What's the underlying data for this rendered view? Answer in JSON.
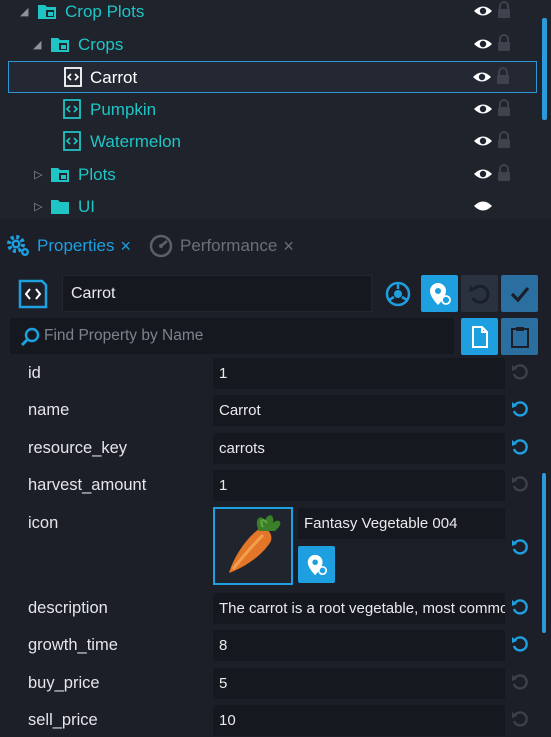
{
  "colors": {
    "accent": "#2c9ad8",
    "tree_text": "#1fc5c5",
    "panel_bg": "#1f232c",
    "field_bg": "#15181e",
    "active_blue": "#1e9fe0",
    "muted": "#6a6f79"
  },
  "tree": {
    "items": [
      {
        "label": "Crop Plots",
        "icon": "folder-icon",
        "expanded": true
      },
      {
        "label": "Crops",
        "icon": "folder-icon",
        "expanded": true
      },
      {
        "label": "Carrot",
        "icon": "script-data-icon",
        "selected": true
      },
      {
        "label": "Pumpkin",
        "icon": "script-data-icon"
      },
      {
        "label": "Watermelon",
        "icon": "script-data-icon"
      },
      {
        "label": "Plots",
        "icon": "folder-icon",
        "expanded": false
      },
      {
        "label": "UI",
        "icon": "folder-icon",
        "expanded": false
      }
    ]
  },
  "tabs": [
    {
      "label": "Properties",
      "active": true,
      "close": "×"
    },
    {
      "label": "Performance",
      "active": false,
      "close": "×"
    }
  ],
  "object": {
    "name": "Carrot"
  },
  "search": {
    "placeholder": "Find Property by Name"
  },
  "properties": [
    {
      "name": "id",
      "value": "1",
      "reset_active": false
    },
    {
      "name": "name",
      "value": "Carrot",
      "reset_active": true
    },
    {
      "name": "resource_key",
      "value": "carrots",
      "reset_active": true
    },
    {
      "name": "harvest_amount",
      "value": "1",
      "reset_active": false
    },
    {
      "name": "icon",
      "value": "Fantasy Vegetable 004",
      "reset_active": true
    },
    {
      "name": "description",
      "value": "The carrot is a root vegetable, most commonly orange in colour",
      "reset_active": true
    },
    {
      "name": "growth_time",
      "value": "8",
      "reset_active": true
    },
    {
      "name": "buy_price",
      "value": "5",
      "reset_active": false
    },
    {
      "name": "sell_price",
      "value": "10",
      "reset_active": false
    }
  ]
}
